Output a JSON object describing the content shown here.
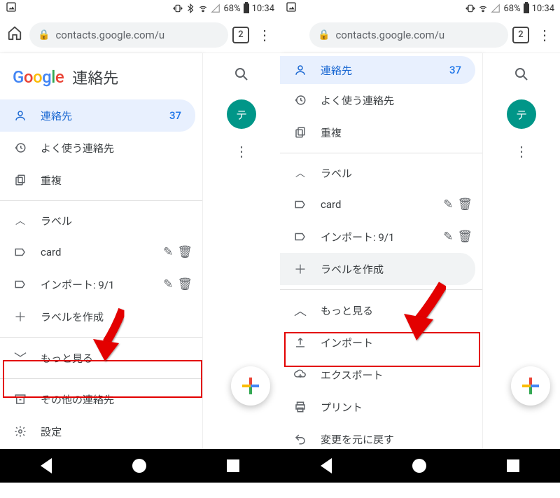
{
  "status": {
    "battery": "68%",
    "time": "10:34"
  },
  "chrome": {
    "url": "contacts.google.com/u",
    "tab_count": "2"
  },
  "logo_title": "連絡先",
  "nav": {
    "contacts": {
      "label": "連絡先",
      "count": "37"
    },
    "frequent": {
      "label": "よく使う連絡先"
    },
    "duplicates": {
      "label": "重複"
    }
  },
  "labels": {
    "header": "ラベル",
    "items": [
      {
        "label": "card"
      },
      {
        "label": "インポート: 9/1"
      }
    ],
    "create": "ラベルを作成"
  },
  "more": {
    "toggle": "もっと見る",
    "import": "インポート",
    "export": "エクスポート",
    "print": "プリント",
    "undo": "変更を元に戻す"
  },
  "other": {
    "other_contacts": "その他の連絡先",
    "settings": "設定"
  },
  "avatar_initial": "テ"
}
